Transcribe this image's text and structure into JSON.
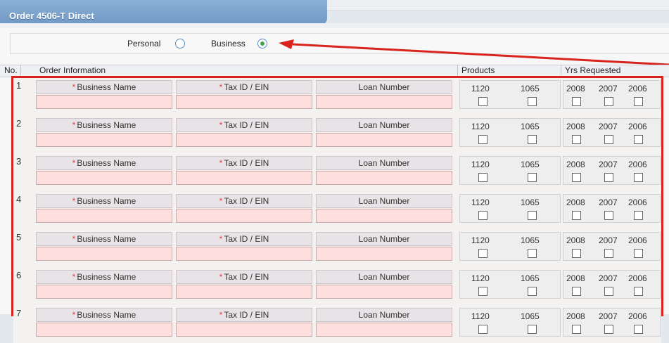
{
  "window": {
    "title": "Order 4506-T Direct"
  },
  "type_selector": {
    "personal_label": "Personal",
    "business_label": "Business",
    "selected": "Business"
  },
  "headers": {
    "no": "No.",
    "order_info": "Order Information",
    "products": "Products",
    "yrs": "Yrs Requested"
  },
  "fields": {
    "business_name": "Business Name",
    "tax_id": "Tax ID / EIN",
    "loan_number": "Loan Number",
    "required_mark": "*"
  },
  "products": [
    "1120",
    "1065"
  ],
  "years": [
    "2008",
    "2007",
    "2006"
  ],
  "rows": [
    "1",
    "2",
    "3",
    "4",
    "5",
    "6",
    "7"
  ],
  "colors": {
    "title_bar": "#7aa3cf",
    "highlight_border": "#d8241d",
    "input_fill": "#fde0dd",
    "required": "#e24141"
  },
  "icons": {
    "radio_selected": "radio-selected-icon",
    "annotation_arrow": "red-arrow-icon"
  }
}
